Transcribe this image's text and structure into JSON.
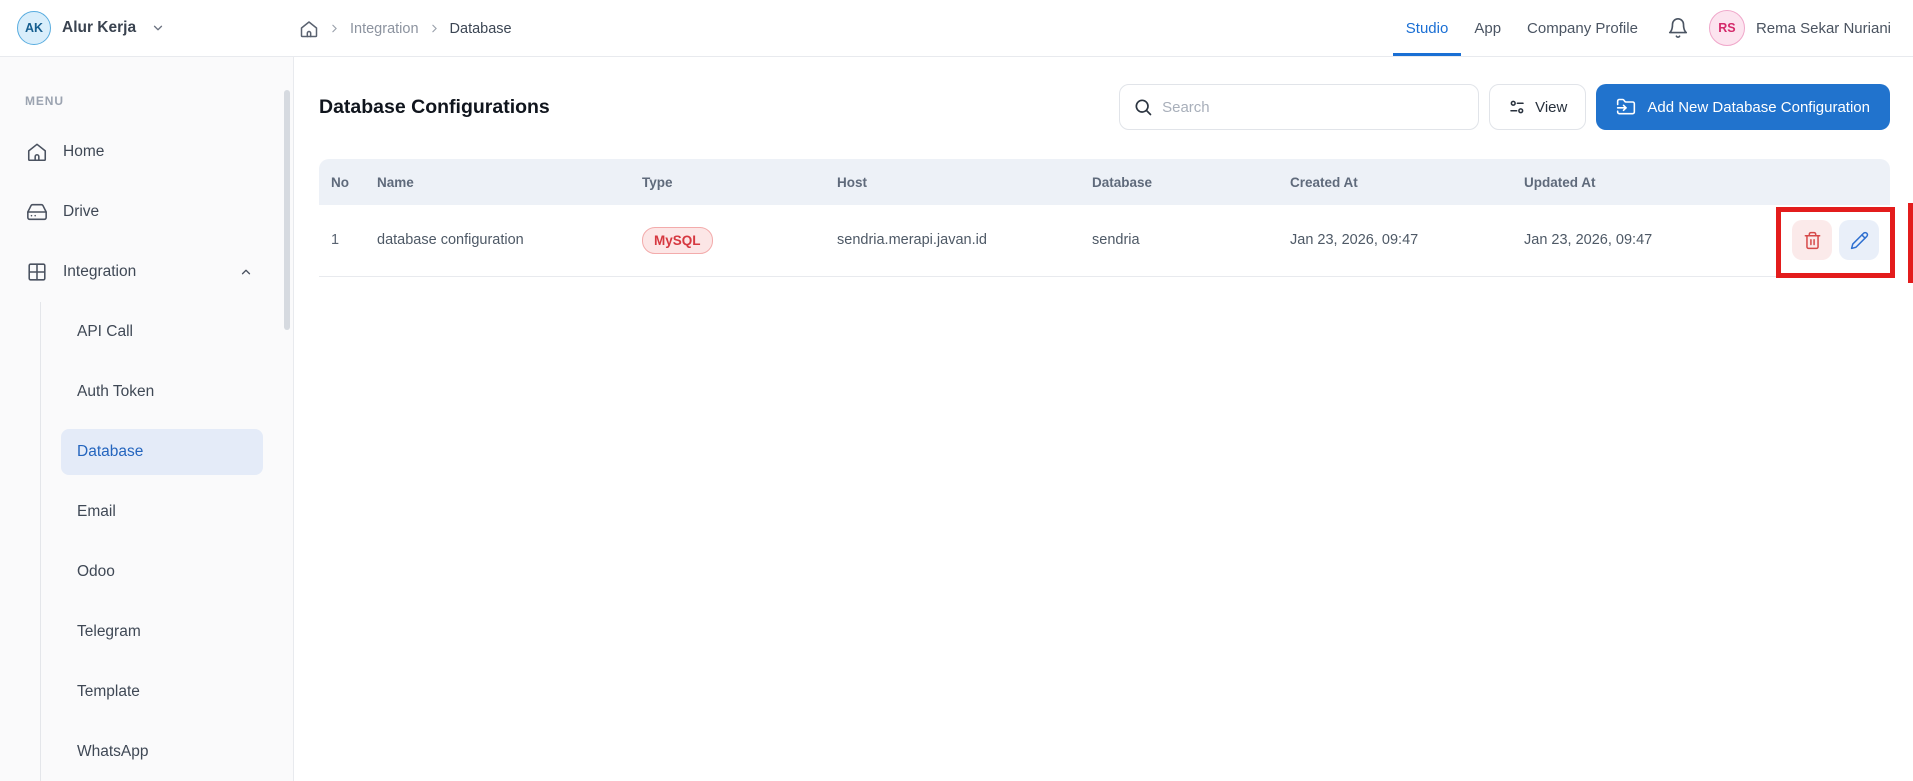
{
  "topbar": {
    "brand": {
      "initials": "AK",
      "name": "Alur Kerja"
    },
    "breadcrumb": {
      "items": [
        "Integration",
        "Database"
      ]
    },
    "tabs": [
      {
        "label": "Studio",
        "active": true
      },
      {
        "label": "App",
        "active": false
      },
      {
        "label": "Company Profile",
        "active": false
      }
    ],
    "user": {
      "initials": "RS",
      "name": "Rema Sekar Nuriani"
    }
  },
  "sidebar": {
    "section_label": "MENU",
    "items": [
      {
        "label": "Home",
        "icon": "home-icon"
      },
      {
        "label": "Drive",
        "icon": "drive-icon"
      },
      {
        "label": "Integration",
        "icon": "grid-icon",
        "expanded": true
      }
    ],
    "integration_children": [
      "API Call",
      "Auth Token",
      "Database",
      "Email",
      "Odoo",
      "Telegram",
      "Template",
      "WhatsApp"
    ],
    "active_child": "Database"
  },
  "main": {
    "title": "Database Configurations",
    "search_placeholder": "Search",
    "view_button": "View",
    "add_button": "Add New Database Configuration"
  },
  "table": {
    "columns": [
      "No",
      "Name",
      "Type",
      "Host",
      "Database",
      "Created At",
      "Updated At"
    ],
    "rows": [
      {
        "no": "1",
        "name": "database configuration",
        "type": "MySQL",
        "host": "sendria.merapi.javan.id",
        "database": "sendria",
        "created_at": "Jan 23, 2026, 09:47",
        "updated_at": "Jan 23, 2026, 09:47"
      }
    ]
  },
  "colors": {
    "accent_blue": "#2173CD",
    "active_tab_blue": "#1A6FD4",
    "active_item_bg": "#E4EBF8",
    "active_item_text": "#2465BE",
    "badge_mysql_bg": "#FCE6E6",
    "badge_mysql_text": "#D63840",
    "delete_icon_red": "#D64949",
    "edit_icon_blue": "#2E6FD0",
    "annotation_red": "#E31C1C",
    "brand_avatar_bg": "#D9EEFB",
    "user_avatar_bg": "#FCE4EF"
  }
}
